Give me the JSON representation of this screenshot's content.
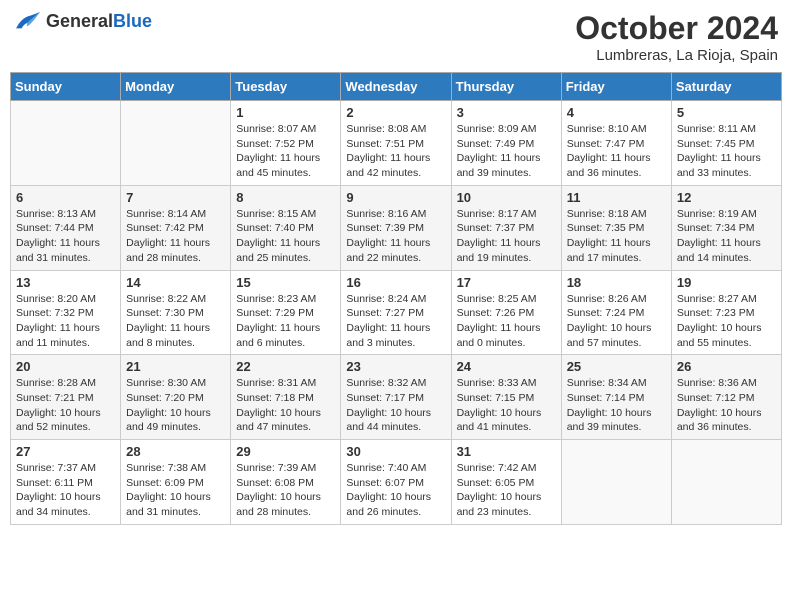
{
  "header": {
    "logo_general": "General",
    "logo_blue": "Blue",
    "title": "October 2024",
    "subtitle": "Lumbreras, La Rioja, Spain"
  },
  "columns": [
    "Sunday",
    "Monday",
    "Tuesday",
    "Wednesday",
    "Thursday",
    "Friday",
    "Saturday"
  ],
  "weeks": [
    [
      {
        "day": "",
        "info": ""
      },
      {
        "day": "",
        "info": ""
      },
      {
        "day": "1",
        "info": "Sunrise: 8:07 AM\nSunset: 7:52 PM\nDaylight: 11 hours and 45 minutes."
      },
      {
        "day": "2",
        "info": "Sunrise: 8:08 AM\nSunset: 7:51 PM\nDaylight: 11 hours and 42 minutes."
      },
      {
        "day": "3",
        "info": "Sunrise: 8:09 AM\nSunset: 7:49 PM\nDaylight: 11 hours and 39 minutes."
      },
      {
        "day": "4",
        "info": "Sunrise: 8:10 AM\nSunset: 7:47 PM\nDaylight: 11 hours and 36 minutes."
      },
      {
        "day": "5",
        "info": "Sunrise: 8:11 AM\nSunset: 7:45 PM\nDaylight: 11 hours and 33 minutes."
      }
    ],
    [
      {
        "day": "6",
        "info": "Sunrise: 8:13 AM\nSunset: 7:44 PM\nDaylight: 11 hours and 31 minutes."
      },
      {
        "day": "7",
        "info": "Sunrise: 8:14 AM\nSunset: 7:42 PM\nDaylight: 11 hours and 28 minutes."
      },
      {
        "day": "8",
        "info": "Sunrise: 8:15 AM\nSunset: 7:40 PM\nDaylight: 11 hours and 25 minutes."
      },
      {
        "day": "9",
        "info": "Sunrise: 8:16 AM\nSunset: 7:39 PM\nDaylight: 11 hours and 22 minutes."
      },
      {
        "day": "10",
        "info": "Sunrise: 8:17 AM\nSunset: 7:37 PM\nDaylight: 11 hours and 19 minutes."
      },
      {
        "day": "11",
        "info": "Sunrise: 8:18 AM\nSunset: 7:35 PM\nDaylight: 11 hours and 17 minutes."
      },
      {
        "day": "12",
        "info": "Sunrise: 8:19 AM\nSunset: 7:34 PM\nDaylight: 11 hours and 14 minutes."
      }
    ],
    [
      {
        "day": "13",
        "info": "Sunrise: 8:20 AM\nSunset: 7:32 PM\nDaylight: 11 hours and 11 minutes."
      },
      {
        "day": "14",
        "info": "Sunrise: 8:22 AM\nSunset: 7:30 PM\nDaylight: 11 hours and 8 minutes."
      },
      {
        "day": "15",
        "info": "Sunrise: 8:23 AM\nSunset: 7:29 PM\nDaylight: 11 hours and 6 minutes."
      },
      {
        "day": "16",
        "info": "Sunrise: 8:24 AM\nSunset: 7:27 PM\nDaylight: 11 hours and 3 minutes."
      },
      {
        "day": "17",
        "info": "Sunrise: 8:25 AM\nSunset: 7:26 PM\nDaylight: 11 hours and 0 minutes."
      },
      {
        "day": "18",
        "info": "Sunrise: 8:26 AM\nSunset: 7:24 PM\nDaylight: 10 hours and 57 minutes."
      },
      {
        "day": "19",
        "info": "Sunrise: 8:27 AM\nSunset: 7:23 PM\nDaylight: 10 hours and 55 minutes."
      }
    ],
    [
      {
        "day": "20",
        "info": "Sunrise: 8:28 AM\nSunset: 7:21 PM\nDaylight: 10 hours and 52 minutes."
      },
      {
        "day": "21",
        "info": "Sunrise: 8:30 AM\nSunset: 7:20 PM\nDaylight: 10 hours and 49 minutes."
      },
      {
        "day": "22",
        "info": "Sunrise: 8:31 AM\nSunset: 7:18 PM\nDaylight: 10 hours and 47 minutes."
      },
      {
        "day": "23",
        "info": "Sunrise: 8:32 AM\nSunset: 7:17 PM\nDaylight: 10 hours and 44 minutes."
      },
      {
        "day": "24",
        "info": "Sunrise: 8:33 AM\nSunset: 7:15 PM\nDaylight: 10 hours and 41 minutes."
      },
      {
        "day": "25",
        "info": "Sunrise: 8:34 AM\nSunset: 7:14 PM\nDaylight: 10 hours and 39 minutes."
      },
      {
        "day": "26",
        "info": "Sunrise: 8:36 AM\nSunset: 7:12 PM\nDaylight: 10 hours and 36 minutes."
      }
    ],
    [
      {
        "day": "27",
        "info": "Sunrise: 7:37 AM\nSunset: 6:11 PM\nDaylight: 10 hours and 34 minutes."
      },
      {
        "day": "28",
        "info": "Sunrise: 7:38 AM\nSunset: 6:09 PM\nDaylight: 10 hours and 31 minutes."
      },
      {
        "day": "29",
        "info": "Sunrise: 7:39 AM\nSunset: 6:08 PM\nDaylight: 10 hours and 28 minutes."
      },
      {
        "day": "30",
        "info": "Sunrise: 7:40 AM\nSunset: 6:07 PM\nDaylight: 10 hours and 26 minutes."
      },
      {
        "day": "31",
        "info": "Sunrise: 7:42 AM\nSunset: 6:05 PM\nDaylight: 10 hours and 23 minutes."
      },
      {
        "day": "",
        "info": ""
      },
      {
        "day": "",
        "info": ""
      }
    ]
  ]
}
